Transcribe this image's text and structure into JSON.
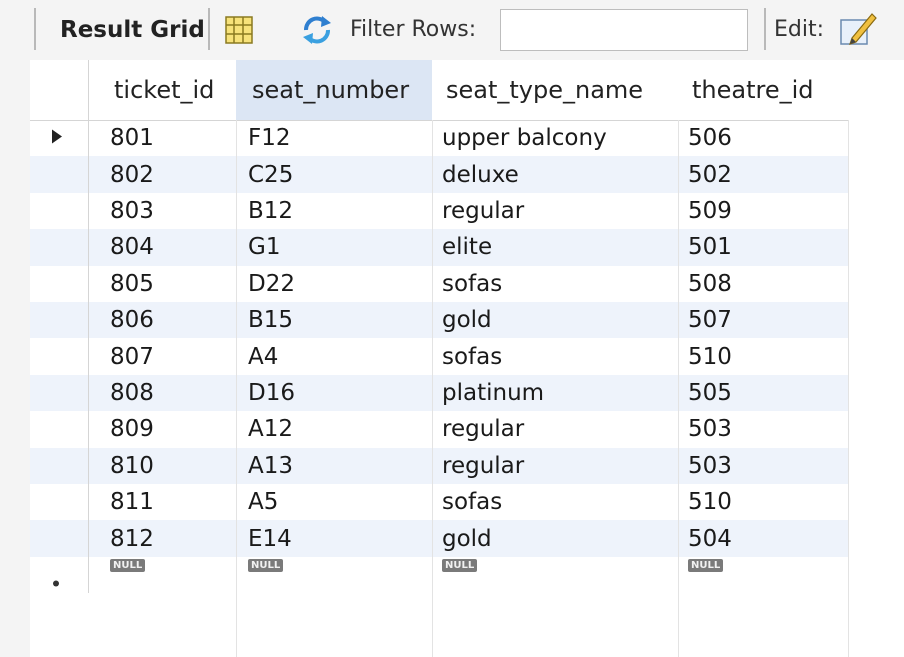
{
  "toolbar": {
    "result_grid_label": "Result Grid",
    "filter_label": "Filter Rows:",
    "filter_value": "",
    "edit_label": "Edit:"
  },
  "grid": {
    "columns": [
      "ticket_id",
      "seat_number",
      "seat_type_name",
      "theatre_id"
    ],
    "rows": [
      [
        "801",
        "F12",
        "upper balcony",
        "506"
      ],
      [
        "802",
        "C25",
        "deluxe",
        "502"
      ],
      [
        "803",
        "B12",
        "regular",
        "509"
      ],
      [
        "804",
        "G1",
        "elite",
        "501"
      ],
      [
        "805",
        "D22",
        "sofas",
        "508"
      ],
      [
        "806",
        "B15",
        "gold",
        "507"
      ],
      [
        "807",
        "A4",
        "sofas",
        "510"
      ],
      [
        "808",
        "D16",
        "platinum",
        "505"
      ],
      [
        "809",
        "A12",
        "regular",
        "503"
      ],
      [
        "810",
        "A13",
        "regular",
        "503"
      ],
      [
        "811",
        "A5",
        "sofas",
        "510"
      ],
      [
        "812",
        "E14",
        "gold",
        "504"
      ]
    ],
    "new_row": [
      "NULL",
      "NULL",
      "NULL",
      "NULL"
    ],
    "current_row_marker": "row-pointer-icon",
    "new_row_marker": "new-row-icon"
  },
  "colors": {
    "alt_row": "#eef3fb",
    "sorted_header": "#dce6f4",
    "null_badge": "#7a7a7a"
  }
}
